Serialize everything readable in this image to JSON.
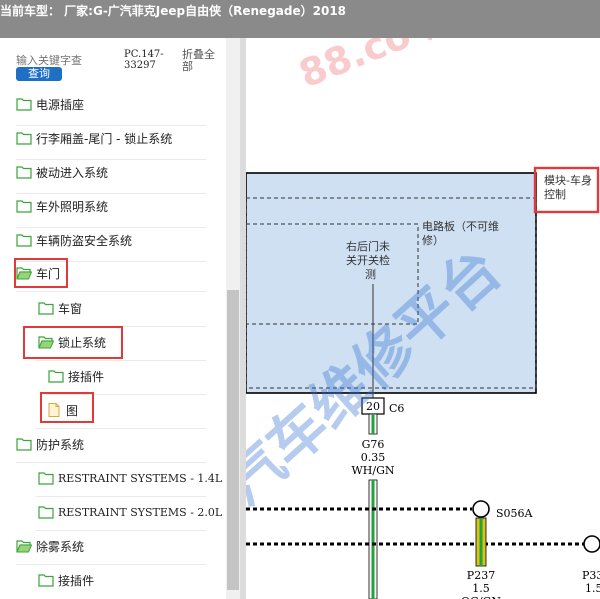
{
  "header": {
    "title": "当前车型： 厂家:G-广汽菲克Jeep自由侠（Renegade）2018"
  },
  "sidebar": {
    "search": {
      "placeholder": "输入关键字查"
    },
    "search_button": "查询",
    "pc_code": "PC.147-33297",
    "collapse_all": "折叠全部",
    "tree": [
      {
        "label": "电源插座",
        "icon": "folder-icon"
      },
      {
        "label": "行李厢盖-尾门 - 锁止系统",
        "icon": "folder-icon"
      },
      {
        "label": "被动进入系统",
        "icon": "folder-icon"
      },
      {
        "label": "车外照明系统",
        "icon": "folder-icon"
      },
      {
        "label": "车辆防盗安全系统",
        "icon": "folder-icon"
      },
      {
        "label": "车门",
        "icon": "folder-open-icon"
      },
      {
        "label": "车窗",
        "icon": "folder-icon"
      },
      {
        "label": "锁止系统",
        "icon": "folder-open-icon"
      },
      {
        "label": "接插件",
        "icon": "folder-icon"
      },
      {
        "label": "图",
        "icon": "document-icon"
      },
      {
        "label": "防护系统",
        "icon": "folder-icon"
      },
      {
        "label": "RESTRAINT SYSTEMS - 1.4L",
        "icon": "folder-icon"
      },
      {
        "label": "RESTRAINT SYSTEMS - 2.0L",
        "icon": "folder-icon"
      },
      {
        "label": "除雾系统",
        "icon": "folder-open-icon"
      },
      {
        "label": "接插件",
        "icon": "folder-icon"
      }
    ]
  },
  "diagram": {
    "watermark": "88.co  汽车维修平台",
    "module_label": "模块-车身控制",
    "board_label": "电路板（不可维修）",
    "sensor_label": "右后门未关开关检测",
    "pin_number": "20",
    "connector": "C6",
    "wire_circuit": "G76",
    "wire_gauge": "0.35",
    "wire_color": "WH/GN",
    "splice": "S056A",
    "wire2_circuit": "P237",
    "wire2_gauge": "1.5",
    "wire2_color": "OG/GN",
    "wire3_circuit": "P33",
    "wire3_gauge": "1.5",
    "colors": {
      "topbar": "#8a8a8a",
      "highlight": "#e03a3a",
      "button": "#1f6fc5",
      "module_fill": "#cfe0f3",
      "wire_green": "#22a33a",
      "wire_yellow": "#d8c31a",
      "watermark": "#2e6fd1"
    }
  }
}
